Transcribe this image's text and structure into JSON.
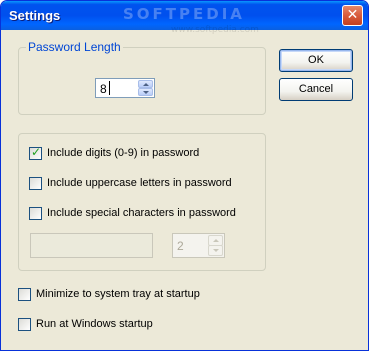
{
  "window": {
    "title": "Settings",
    "watermark": "SOFTPEDIA",
    "watermark_sub": "www.softpedia.com"
  },
  "password_group": {
    "title": "Password Length",
    "value": "8"
  },
  "buttons": {
    "ok": "OK",
    "cancel": "Cancel"
  },
  "options": [
    {
      "label": "Include digits (0-9) in password",
      "checked": true
    },
    {
      "label": "Include uppercase letters in password",
      "checked": false
    },
    {
      "label": "Include special characters in password",
      "checked": false
    }
  ],
  "special": {
    "chars_value": "",
    "count_value": "2"
  },
  "startup": [
    {
      "label": "Minimize to system tray at startup",
      "checked": false
    },
    {
      "label": "Run at Windows startup",
      "checked": false
    }
  ],
  "colors": {
    "titlebar": "#0054e3",
    "group_title": "#0046d5",
    "checkmark": "#21a121"
  },
  "icons": {
    "close": "close-icon",
    "spin_up": "chevron-up-icon",
    "spin_down": "chevron-down-icon",
    "check": "checkmark-icon"
  }
}
